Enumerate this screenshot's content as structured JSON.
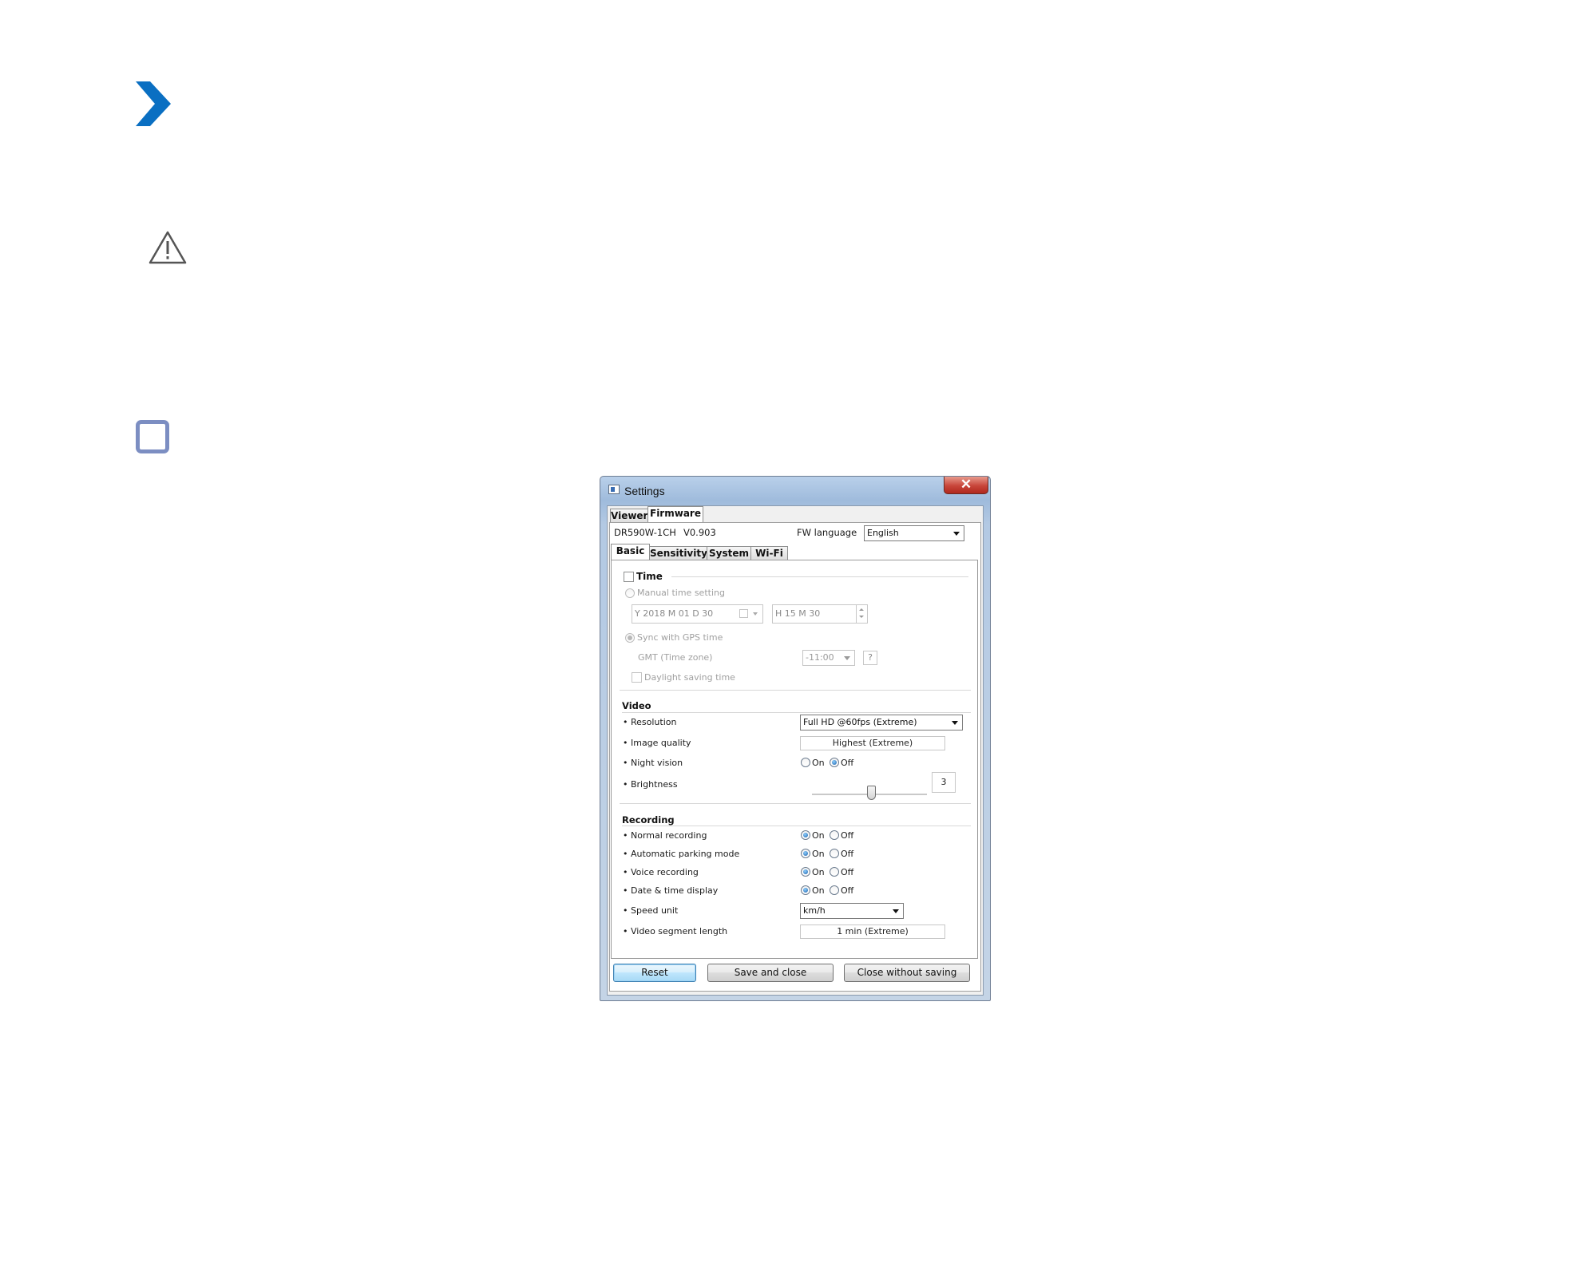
{
  "page": {
    "chevron_icon": "chevron-right-icon",
    "warning_icon": "warning-triangle-icon",
    "checkbox_icon": "checkbox-outline-icon",
    "accent_color": "#0a6fc2"
  },
  "window": {
    "title": "Settings",
    "close_symbol": "✕",
    "top_tabs": [
      "Viewer",
      "Firmware"
    ],
    "active_top_tab": "Firmware"
  },
  "firmware": {
    "model": "DR590W-1CH",
    "version": "V0.903",
    "fw_language_label": "FW language",
    "fw_language_value": "English"
  },
  "sub_tabs": [
    "Basic",
    "Sensitivity",
    "System",
    "Wi-Fi"
  ],
  "active_sub_tab": "Basic",
  "time": {
    "header": "Time",
    "manual_label": "Manual time setting",
    "date_value": "Y 2018 M 01 D 30",
    "time_value": "H 15 M 30",
    "sync_label": "Sync with GPS time",
    "gmt_label": "GMT (Time zone)",
    "gmt_value": "-11:00",
    "help_label": "?",
    "dst_label": "Daylight saving time"
  },
  "video": {
    "header": "Video",
    "resolution_label": "• Resolution",
    "resolution_value": "Full HD @60fps (Extreme)",
    "image_quality_label": "• Image quality",
    "image_quality_value": "Highest (Extreme)",
    "night_vision_label": "• Night vision",
    "night_vision_value": "Off",
    "brightness_label": "• Brightness",
    "brightness_value": "3",
    "on_label": "On",
    "off_label": "Off"
  },
  "recording": {
    "header": "Recording",
    "rows": [
      {
        "label": "• Normal recording",
        "value": "On"
      },
      {
        "label": "• Automatic parking mode",
        "value": "On"
      },
      {
        "label": "• Voice recording",
        "value": "On"
      },
      {
        "label": "• Date & time display",
        "value": "On"
      }
    ],
    "on_label": "On",
    "off_label": "Off",
    "speed_unit_label": "• Speed unit",
    "speed_unit_value": "km/h",
    "segment_label": "• Video segment length",
    "segment_value": "1 min  (Extreme)"
  },
  "buttons": {
    "reset": "Reset",
    "save_close": "Save and close",
    "close_no_save": "Close without saving"
  }
}
